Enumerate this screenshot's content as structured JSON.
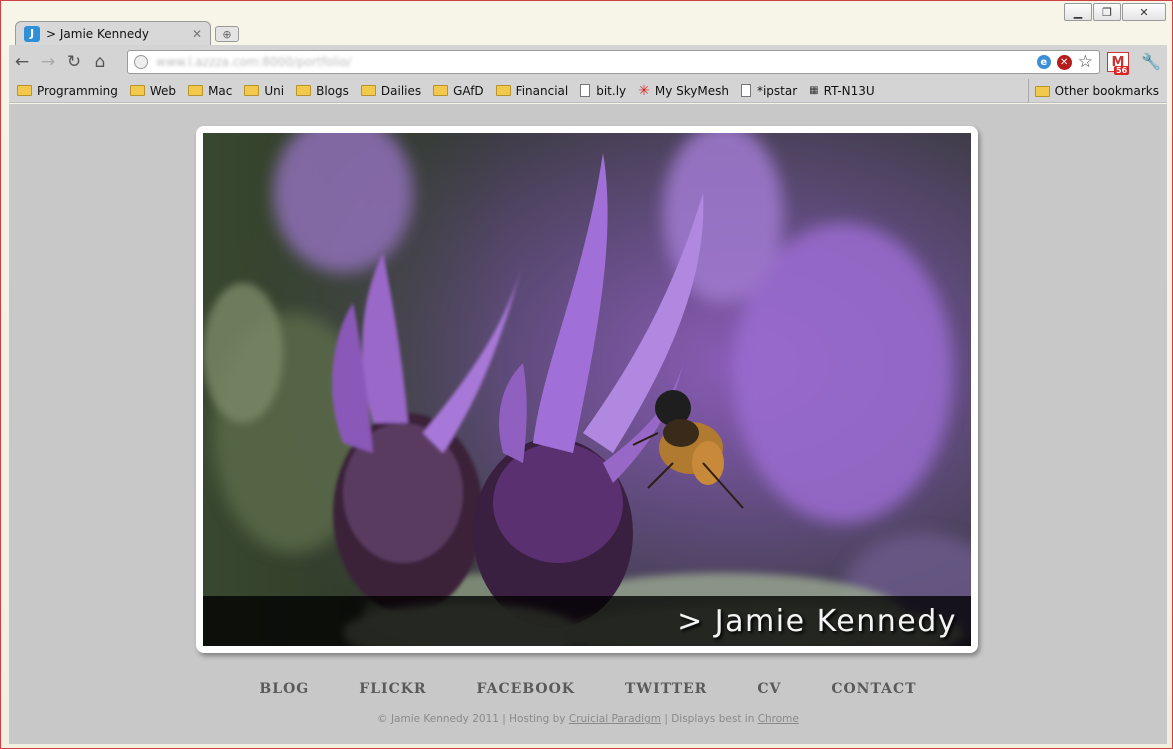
{
  "window": {
    "controls": [
      "minimize",
      "restore",
      "close"
    ]
  },
  "tab": {
    "favicon_letter": "J",
    "title": "> Jamie Kennedy"
  },
  "toolbar": {
    "url": "www.l.azzza.com:8000/portfolio/"
  },
  "extensions": {
    "gmail_count": "56"
  },
  "bookmarks": {
    "items": [
      {
        "label": "Programming",
        "type": "folder"
      },
      {
        "label": "Web",
        "type": "folder"
      },
      {
        "label": "Mac",
        "type": "folder"
      },
      {
        "label": "Uni",
        "type": "folder"
      },
      {
        "label": "Blogs",
        "type": "folder"
      },
      {
        "label": "Dailies",
        "type": "folder"
      },
      {
        "label": "GAfD",
        "type": "folder"
      },
      {
        "label": "Financial",
        "type": "folder"
      },
      {
        "label": "bit.ly",
        "type": "page"
      },
      {
        "label": "My SkyMesh",
        "type": "skymesh"
      },
      {
        "label": "*ipstar",
        "type": "page"
      },
      {
        "label": "RT-N13U",
        "type": "router"
      }
    ],
    "other": "Other bookmarks"
  },
  "hero": {
    "caption": "> Jamie Kennedy"
  },
  "nav": {
    "blog": "BLOG",
    "flickr": "FLICKR",
    "facebook": "FACEBOOK",
    "twitter": "TWITTER",
    "cv": "CV",
    "contact": "CONTACT"
  },
  "footer": {
    "copyright": "© Jamie Kennedy 2011 | Hosting by ",
    "hosting_link": "Cruicial Paradigm",
    "middle": " | Displays best in ",
    "browser_link": "Chrome"
  }
}
